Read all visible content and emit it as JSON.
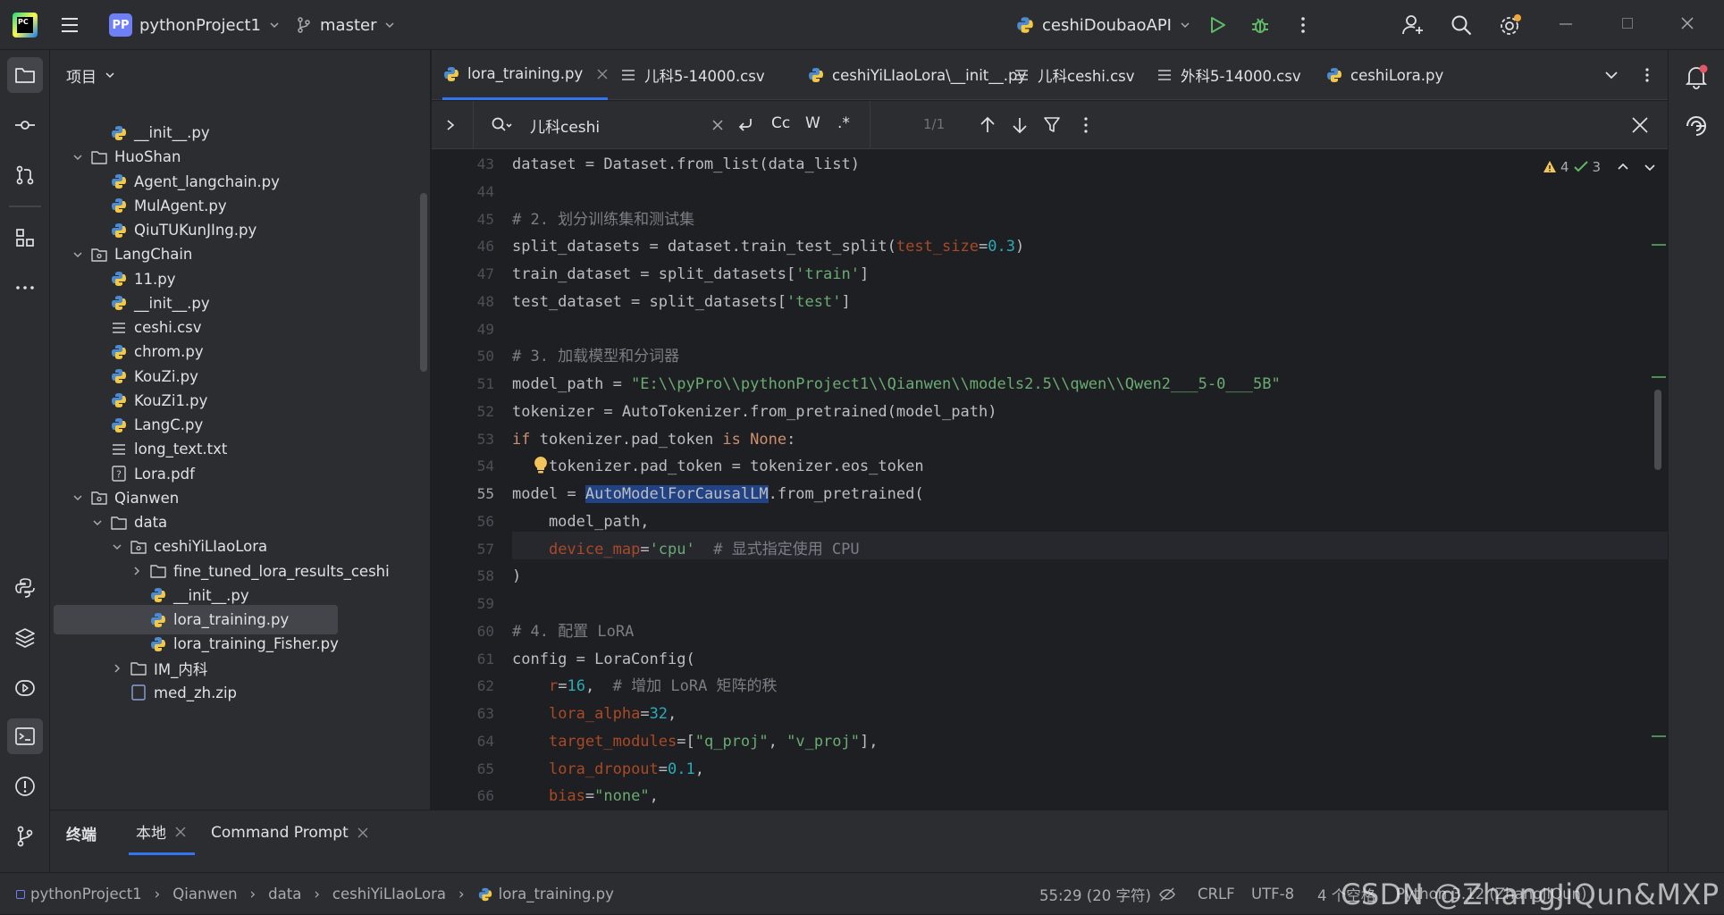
{
  "titlebar": {
    "project_badge": "PP",
    "project": "pythonProject1",
    "branch": "master",
    "run_config": "ceshiDoubaoAPI"
  },
  "project_panel": {
    "title": "项目",
    "rows": [
      {
        "label": "__init__.py",
        "icon": "python-file-icon",
        "indent": 3
      },
      {
        "label": "HuoShan",
        "icon": "folder-icon",
        "indent": 2,
        "expanded": true
      },
      {
        "label": "Agent_langchain.py",
        "icon": "python-file-icon",
        "indent": 3
      },
      {
        "label": "MulAgent.py",
        "icon": "python-file-icon",
        "indent": 3
      },
      {
        "label": "QiuTUKunJIng.py",
        "icon": "python-file-icon",
        "indent": 3
      },
      {
        "label": "LangChain",
        "icon": "package-icon",
        "indent": 2,
        "expanded": true
      },
      {
        "label": "11.py",
        "icon": "python-file-icon",
        "indent": 3
      },
      {
        "label": "__init__.py",
        "icon": "python-file-icon",
        "indent": 3
      },
      {
        "label": "ceshi.csv",
        "icon": "text-file-icon",
        "indent": 3
      },
      {
        "label": "chrom.py",
        "icon": "python-file-icon",
        "indent": 3
      },
      {
        "label": "KouZi.py",
        "icon": "python-file-icon",
        "indent": 3
      },
      {
        "label": "KouZi1.py",
        "icon": "python-file-icon",
        "indent": 3
      },
      {
        "label": "LangC.py",
        "icon": "python-file-icon",
        "indent": 3
      },
      {
        "label": "long_text.txt",
        "icon": "text-file-icon",
        "indent": 3
      },
      {
        "label": "Lora.pdf",
        "icon": "unknown-file-icon",
        "indent": 3
      },
      {
        "label": "Qianwen",
        "icon": "package-icon",
        "indent": 2,
        "expanded": true
      },
      {
        "label": "data",
        "icon": "folder-icon",
        "indent": 3,
        "expanded": true
      },
      {
        "label": "ceshiYiLIaoLora",
        "icon": "package-icon",
        "indent": 4,
        "expanded": true
      },
      {
        "label": "fine_tuned_lora_results_ceshi",
        "icon": "folder-icon",
        "indent": 5,
        "expanded": false
      },
      {
        "label": "__init__.py",
        "icon": "python-file-icon",
        "indent": 5
      },
      {
        "label": "lora_training.py",
        "icon": "python-file-icon",
        "indent": 5,
        "selected": true
      },
      {
        "label": "lora_training_Fisher.py",
        "icon": "python-file-icon",
        "indent": 5
      },
      {
        "label": "IM_内科",
        "icon": "folder-icon",
        "indent": 4,
        "expanded": false
      },
      {
        "label": "med_zh.zip",
        "icon": "zip-file-icon",
        "indent": 4
      }
    ]
  },
  "tabs": [
    {
      "label": "lora_training.py",
      "icon": "python-file-icon",
      "active": true,
      "closable": true
    },
    {
      "label": "儿科5-14000.csv",
      "icon": "text-file-icon"
    },
    {
      "label": "ceshiYiLIaoLora\\__init__.py",
      "icon": "python-file-icon"
    },
    {
      "label": "儿科ceshi.csv",
      "icon": "text-file-icon"
    },
    {
      "label": "外科5-14000.csv",
      "icon": "text-file-icon"
    },
    {
      "label": "ceshiLora.py",
      "icon": "python-file-icon"
    }
  ],
  "find": {
    "query": "儿科ceshi",
    "case_label": "Cc",
    "word_label": "W",
    "regex_label": ".*",
    "count": "1/1"
  },
  "inspections": {
    "warnings": "4",
    "ok": "3"
  },
  "editor": {
    "current_line": "55",
    "lines": [
      {
        "n": "43",
        "t": [
          [
            "dataset = Dataset.from_list(data_list)",
            ""
          ]
        ]
      },
      {
        "n": "44",
        "t": []
      },
      {
        "n": "45",
        "t": [
          [
            "# 2. 划分训练集和测试集",
            "cm"
          ]
        ]
      },
      {
        "n": "46",
        "t": [
          [
            "split_datasets = dataset.train_test_split(",
            ""
          ],
          [
            "test_size",
            "par"
          ],
          [
            "=",
            ""
          ],
          [
            "0.3",
            "num"
          ],
          [
            ")",
            ""
          ]
        ]
      },
      {
        "n": "47",
        "t": [
          [
            "train_dataset = split_datasets[",
            ""
          ],
          [
            "'train'",
            "str"
          ],
          [
            "]",
            ""
          ]
        ]
      },
      {
        "n": "48",
        "t": [
          [
            "test_dataset = split_datasets[",
            ""
          ],
          [
            "'test'",
            "str"
          ],
          [
            "]",
            ""
          ]
        ]
      },
      {
        "n": "49",
        "t": []
      },
      {
        "n": "50",
        "t": [
          [
            "# 3. 加载模型和分词器",
            "cm"
          ]
        ]
      },
      {
        "n": "51",
        "t": [
          [
            "model_path = ",
            ""
          ],
          [
            "\"E:\\\\pyPro\\\\pythonProject1\\\\Qianwen\\\\models2.5\\\\qwen\\\\Qwen2___5-0___5B\"",
            "str"
          ]
        ]
      },
      {
        "n": "52",
        "t": [
          [
            "tokenizer = AutoTokenizer.from_pretrained(model_path)",
            ""
          ]
        ]
      },
      {
        "n": "53",
        "t": [
          [
            "if",
            "kw"
          ],
          [
            " tokenizer.pad_token ",
            ""
          ],
          [
            "is",
            "kw"
          ],
          [
            " ",
            ""
          ],
          [
            "None",
            "kw"
          ],
          [
            ":",
            ""
          ]
        ]
      },
      {
        "n": "54",
        "t": [
          [
            "    tokenizer.pad_token = tokenizer.eos_token",
            ""
          ]
        ]
      },
      {
        "n": "55",
        "t": [
          [
            "model = ",
            ""
          ],
          [
            "AutoModelForCausalLM",
            "sel"
          ],
          [
            ".from_pretrained(",
            ""
          ]
        ]
      },
      {
        "n": "56",
        "t": [
          [
            "    model_path,",
            ""
          ]
        ]
      },
      {
        "n": "57",
        "t": [
          [
            "    ",
            ""
          ],
          [
            "device_map",
            "par"
          ],
          [
            "=",
            ""
          ],
          [
            "'cpu'",
            "str"
          ],
          [
            "  # 显式指定使用 CPU",
            "cm"
          ]
        ]
      },
      {
        "n": "58",
        "t": [
          [
            ")",
            ""
          ]
        ]
      },
      {
        "n": "59",
        "t": []
      },
      {
        "n": "60",
        "t": [
          [
            "# 4. 配置 LoRA",
            "cm"
          ]
        ]
      },
      {
        "n": "61",
        "t": [
          [
            "config = LoraConfig(",
            ""
          ]
        ]
      },
      {
        "n": "62",
        "t": [
          [
            "    ",
            ""
          ],
          [
            "r",
            "par"
          ],
          [
            "=",
            ""
          ],
          [
            "16",
            "num"
          ],
          [
            ",  ",
            ""
          ],
          [
            "# 增加 LoRA 矩阵的秩",
            "cm"
          ]
        ]
      },
      {
        "n": "63",
        "t": [
          [
            "    ",
            ""
          ],
          [
            "lora_alpha",
            "par"
          ],
          [
            "=",
            ""
          ],
          [
            "32",
            "num"
          ],
          [
            ",",
            ""
          ]
        ]
      },
      {
        "n": "64",
        "t": [
          [
            "    ",
            ""
          ],
          [
            "target_modules",
            "par"
          ],
          [
            "=[",
            ""
          ],
          [
            "\"q_proj\"",
            "str"
          ],
          [
            ", ",
            ""
          ],
          [
            "\"v_proj\"",
            "str"
          ],
          [
            "],",
            ""
          ]
        ]
      },
      {
        "n": "65",
        "t": [
          [
            "    ",
            ""
          ],
          [
            "lora_dropout",
            "par"
          ],
          [
            "=",
            ""
          ],
          [
            "0.1",
            "num"
          ],
          [
            ",",
            ""
          ]
        ]
      },
      {
        "n": "66",
        "t": [
          [
            "    ",
            ""
          ],
          [
            "bias",
            "par"
          ],
          [
            "=",
            ""
          ],
          [
            "\"none\"",
            "str"
          ],
          [
            ",",
            ""
          ]
        ]
      }
    ]
  },
  "terminal": {
    "title": "终端",
    "tabs": [
      {
        "label": "本地",
        "active": true
      },
      {
        "label": "Command Prompt"
      }
    ]
  },
  "status": {
    "breadcrumb": [
      "pythonProject1",
      "Qianwen",
      "data",
      "ceshiYiLIaoLora",
      "lora_training.py"
    ],
    "position": "55:29 (20 字符)",
    "line_sep": "CRLF",
    "encoding": "UTF-8",
    "indent": "4 个空格",
    "interpreter": "Python 3.12 (ZhangJiQun)",
    "watermark": "CSDN @ZhangJiQun&MXP"
  },
  "colors": {
    "accent": "#3574f0",
    "run": "#5fb865",
    "warning": "#f2c55c",
    "ok": "#5fb865",
    "badge": "#6f7ff5"
  }
}
